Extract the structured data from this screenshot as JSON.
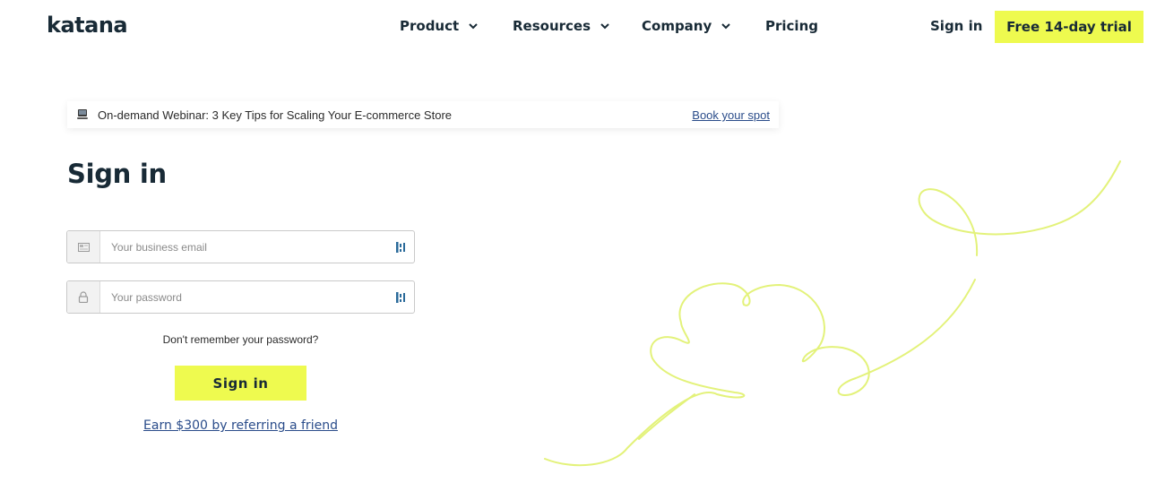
{
  "header": {
    "logo": "katana",
    "nav": [
      {
        "label": "Product",
        "icon": "chevron-down-icon"
      },
      {
        "label": "Resources",
        "icon": "chevron-down-icon"
      },
      {
        "label": "Company",
        "icon": "chevron-down-icon"
      },
      {
        "label": "Pricing"
      }
    ],
    "sign_in": "Sign in",
    "trial_button": "Free 14-day trial"
  },
  "banner": {
    "icon": "laptop-icon",
    "text": "On-demand Webinar: 3 Key Tips for Scaling Your E-commerce Store",
    "link": "Book your spot"
  },
  "form": {
    "title": "Sign in",
    "email": {
      "placeholder": "Your business email",
      "value": "",
      "icon": "envelope-icon",
      "end_icon": "password-manager-icon"
    },
    "password": {
      "placeholder": "Your password",
      "value": "",
      "icon": "lock-icon",
      "end_icon": "password-manager-icon"
    },
    "forgot": "Don't remember your password?",
    "submit": "Sign in",
    "referral": "Earn $300 by referring a friend"
  },
  "colors": {
    "accent": "#eefa4f",
    "text": "#182a36",
    "link": "#2a4c8a",
    "decor_line": "#e3f27a"
  }
}
